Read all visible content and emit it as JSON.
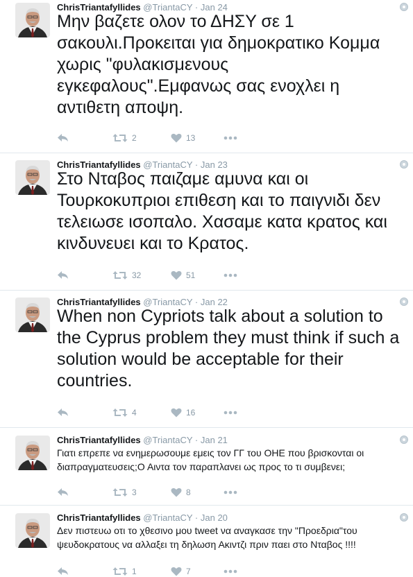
{
  "tweets": [
    {
      "name": "ChrisTriantafyllides",
      "handle": "@TriantaCY",
      "date": "Jan 24",
      "text": "Μην βαζετε ολον το ΔΗΣΥ σε 1 σακουλι.Προκειται για δημοκρατικο Κομμα χωρις \"φυλακισμενους εγκεφαλους\".Εμφανως σας ενοχλει η αντιθετη αποψη.",
      "retweets": "2",
      "likes": "13"
    },
    {
      "name": "ChrisTriantafyllides",
      "handle": "@TriantaCY",
      "date": "Jan 23",
      "text": "Στο Νταβος παιζαμε αμυνα και οι Τουρκοκυπριοι επιθεση και το παιγνιδι δεν τελειωσε ισοπαλο. Χασαμε κατα κρατος και κινδυνευει και το Κρατος.",
      "retweets": "32",
      "likes": "51"
    },
    {
      "name": "ChrisTriantafyllides",
      "handle": "@TriantaCY",
      "date": "Jan 22",
      "text": "When non Cypriots talk about a solution to the Cyprus problem they must think if such a solution would be acceptable for their countries.",
      "retweets": "4",
      "likes": "16"
    },
    {
      "name": "ChrisTriantafyllides",
      "handle": "@TriantaCY",
      "date": "Jan 21",
      "text": "Γιατι επρεπε να ενημερωσουμε εμεις τον ΓΓ του ΟΗΕ που βρισκονται οι διαπραγματευσεις;Ο Αιντα τον παραπλανει ως προς το τι συμβενει;",
      "retweets": "3",
      "likes": "8"
    },
    {
      "name": "ChrisTriantafyllides",
      "handle": "@TriantaCY",
      "date": "Jan 20",
      "text": "Δεν πιστευω οτι το χθεσινο μου tweet να αναγκασε την \"Προεδρια\"του ψευδοκρατους να αλλαξει τη δηλωση Ακιντζι πριν παει στο Νταβος !!!!",
      "retweets": "1",
      "likes": "7"
    }
  ],
  "icons": {
    "reply": "reply-icon",
    "retweet": "retweet-icon",
    "like": "heart-icon",
    "more": "more-dots-icon",
    "caret": "dropdown-caret-icon"
  },
  "colors": {
    "text": "#14171a",
    "muted": "#8899a6",
    "divider": "#e1e8ed"
  }
}
